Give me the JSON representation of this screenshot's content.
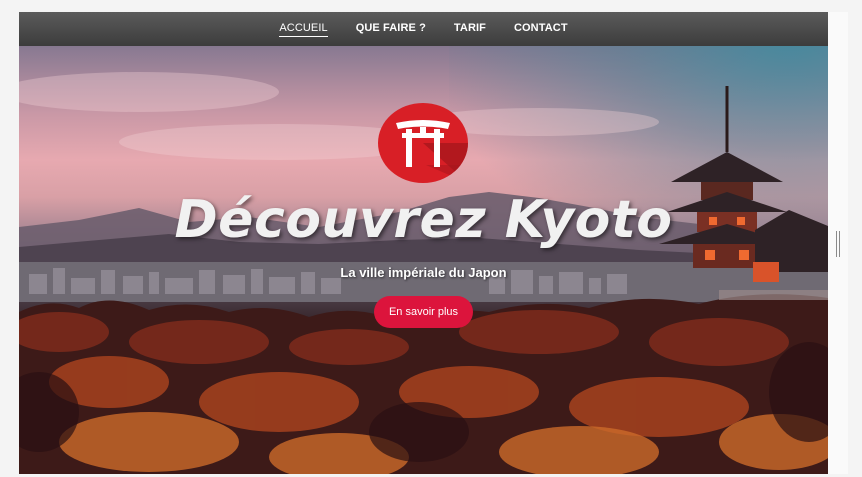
{
  "nav": {
    "items": [
      {
        "label": "ACCUEIL",
        "active": true
      },
      {
        "label": "QUE FAIRE ?",
        "active": false
      },
      {
        "label": "TARIF",
        "active": false
      },
      {
        "label": "CONTACT",
        "active": false
      }
    ]
  },
  "hero": {
    "logo_icon": "torii-gate-icon",
    "title": "Découvrez Kyoto",
    "subtitle": "La ville impériale du Japon",
    "cta_label": "En savoir plus"
  },
  "colors": {
    "brand_red": "#dc143c",
    "logo_red": "#d81f26",
    "nav_bg": "#4a4a4a"
  }
}
